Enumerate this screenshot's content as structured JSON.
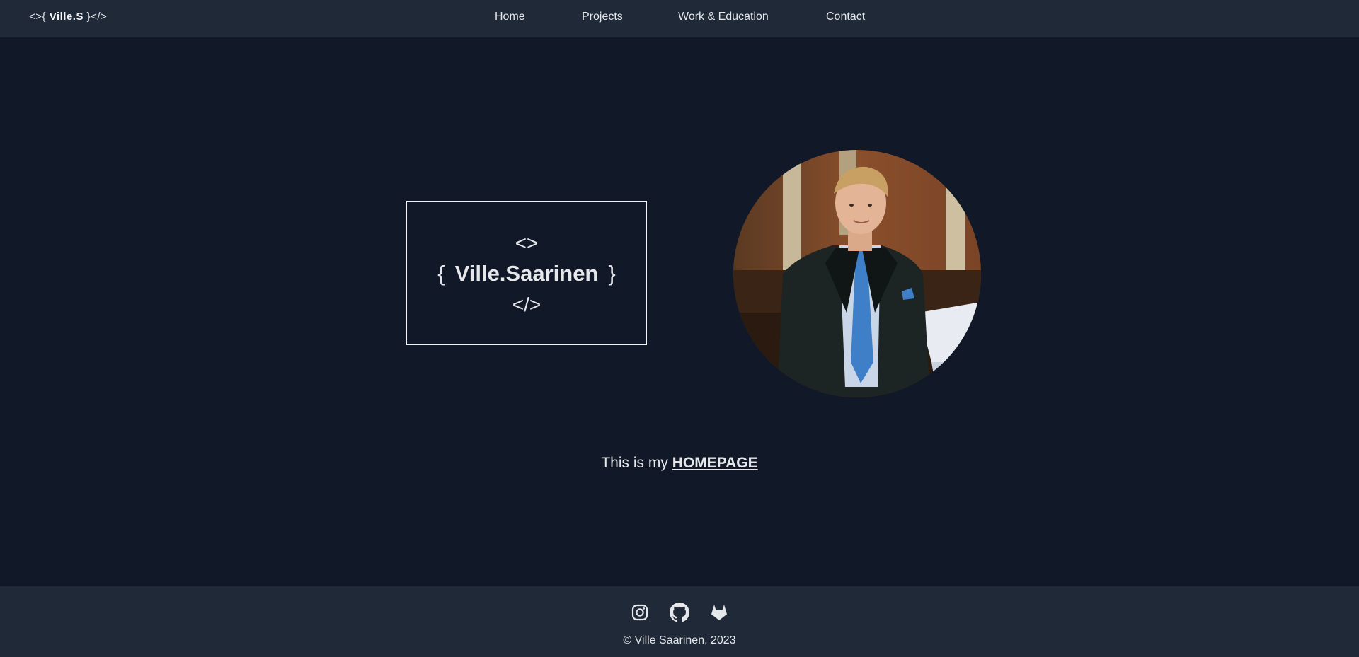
{
  "nav": {
    "brand_prefix": "<>{ ",
    "brand_name": "Ville.S",
    "brand_suffix": " }</>",
    "links": [
      {
        "label": "Home"
      },
      {
        "label": "Projects"
      },
      {
        "label": "Work & Education"
      },
      {
        "label": "Contact"
      }
    ]
  },
  "hero": {
    "line_top": "<>",
    "brace_open": "{",
    "name": "Ville.Saarinen",
    "brace_close": "}",
    "line_bottom": "</>"
  },
  "tagline": {
    "prefix": "This is my ",
    "link": "HOMEPAGE"
  },
  "footer": {
    "social": [
      {
        "icon": "instagram-icon"
      },
      {
        "icon": "github-icon"
      },
      {
        "icon": "gitlab-icon"
      }
    ],
    "copyright": "© Ville Saarinen, 2023"
  },
  "colors": {
    "background": "#111827",
    "bar": "#1f2937",
    "text": "#e5e7eb"
  }
}
